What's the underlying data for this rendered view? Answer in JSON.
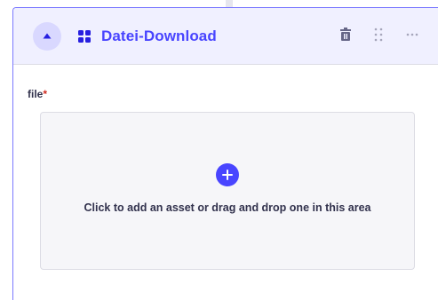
{
  "component": {
    "title": "Datei-Download",
    "toggle_icon": "caret-up-icon",
    "component_icon": "grid-icon",
    "actions": [
      {
        "name": "delete",
        "icon": "trash-icon"
      },
      {
        "name": "drag",
        "icon": "drag-handle-icon"
      },
      {
        "name": "more",
        "icon": "more-icon"
      }
    ]
  },
  "field": {
    "label": "file",
    "required_mark": "*"
  },
  "dropzone": {
    "icon": "plus-icon",
    "text": "Click to add an asset or drag and drop one in this area"
  },
  "colors": {
    "accent": "#4945ff",
    "header_bg": "#f0f0ff",
    "dropzone_bg": "#f6f6f9",
    "required": "#d02b20"
  }
}
